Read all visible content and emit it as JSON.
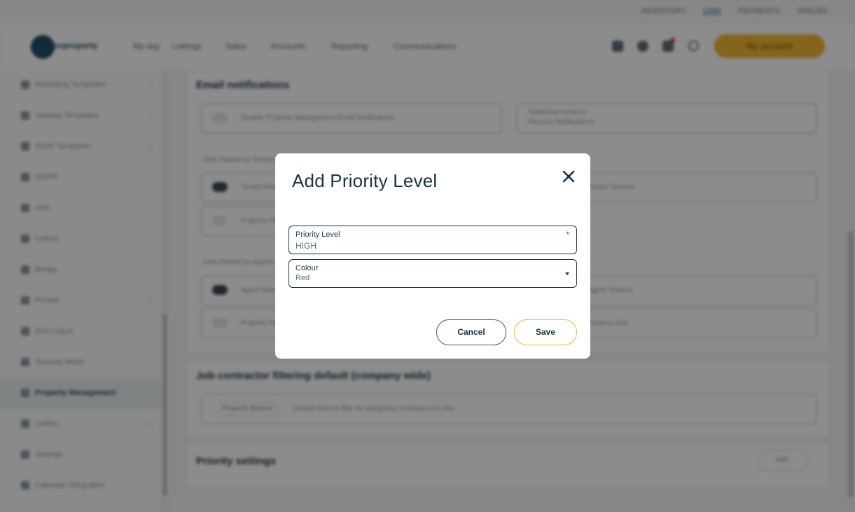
{
  "util_bar": {
    "items": [
      "INVENTORY",
      "CRM",
      "PAYMENTS",
      "SPACES"
    ],
    "active_index": 1
  },
  "nav": {
    "logo_text": "ooproperty",
    "links": [
      "My day",
      "Lettings",
      "Sales",
      "Accounts",
      "Reporting",
      "Communications"
    ],
    "account_label": "My account"
  },
  "sidebar": {
    "items": [
      {
        "label": "Marketing Templates",
        "has_chevron": true
      },
      {
        "label": "Viewing Templates",
        "has_chevron": true
      },
      {
        "label": "ROID Templates",
        "has_chevron": true
      },
      {
        "label": "GDPR",
        "has_chevron": false
      },
      {
        "label": "AML",
        "has_chevron": false
      },
      {
        "label": "Letters",
        "has_chevron": false
      },
      {
        "label": "Bridge",
        "has_chevron": false
      },
      {
        "label": "Portals",
        "has_chevron": true
      },
      {
        "label": "Geo Log-In",
        "has_chevron": false
      },
      {
        "label": "Security Mode",
        "has_chevron": false
      },
      {
        "label": "Property Management",
        "has_chevron": false,
        "active": true
      },
      {
        "label": "LetBox",
        "has_chevron": true
      },
      {
        "label": "Settings",
        "has_chevron": false
      },
      {
        "label": "Calendar Integration",
        "has_chevron": false
      }
    ]
  },
  "content": {
    "email_card": {
      "title": "Email notifications",
      "disable_toggle_label": "Disable Property Management Email Notifications",
      "additional_email_label": "Additional email to",
      "additional_email_sub": "Receive Notifications",
      "section_tenant": "Jobs Raised by Tenants",
      "section_agent": "Jobs Raised by Agents",
      "row_tenant_1": "Tenant Raised",
      "row_tenant_2": "Property Raised",
      "right_tenant": "Tenant Tenants",
      "row_agent_1": "Agent Raised",
      "row_agent_2": "Property Raised",
      "right_agent_1": "Agent Tenants",
      "right_agent_2": "Tenancy Unit"
    },
    "contractor_card": {
      "title": "Job contractor filtering default (company wide)",
      "pill_label": "Property Branch",
      "description": "Default branch filter for assigning contractors to jobs"
    },
    "priority_card": {
      "title": "Priority settings",
      "add_label": "Add"
    }
  },
  "modal": {
    "title": "Add Priority Level",
    "priority_field": {
      "label": "Priority Level",
      "value": "HIGH",
      "required_mark": "*"
    },
    "colour_field": {
      "label": "Colour",
      "value": "Red"
    },
    "cancel_label": "Cancel",
    "save_label": "Save"
  },
  "colors": {
    "accent": "#f2b634",
    "primary_dark": "#163447",
    "required": "#d8343b"
  }
}
